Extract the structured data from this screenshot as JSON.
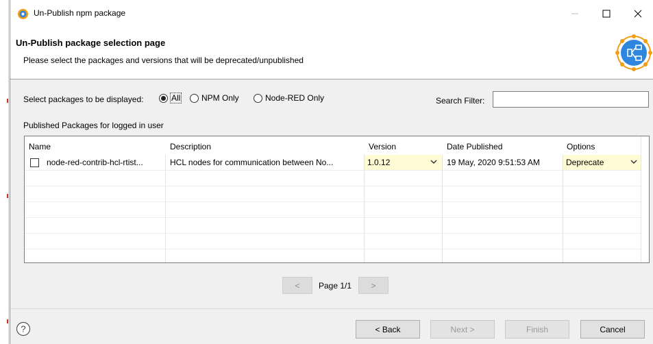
{
  "window": {
    "title": "Un-Publish npm package",
    "minimize": "—",
    "maximize": "☐",
    "close": "✕"
  },
  "banner": {
    "title": "Un-Publish package selection page",
    "description": "Please select the packages and versions that will be deprecated/unpublished",
    "icon": "npm-package-icon"
  },
  "filter": {
    "label": "Select packages to be displayed:",
    "options": [
      {
        "label": "All",
        "selected": true
      },
      {
        "label": "NPM Only",
        "selected": false
      },
      {
        "label": "Node-RED Only",
        "selected": false
      }
    ],
    "search_label": "Search Filter:",
    "search_value": ""
  },
  "table": {
    "section_label": "Published Packages for logged in user",
    "columns": [
      "Name",
      "Description",
      "Version",
      "Date Published",
      "Options"
    ],
    "rows": [
      {
        "checked": false,
        "name": "node-red-contrib-hcl-rtist...",
        "description": "HCL nodes for communication between No...",
        "version": "1.0.12",
        "date": "19 May, 2020 9:51:53 AM",
        "option": "Deprecate"
      }
    ]
  },
  "pager": {
    "prev": "<",
    "text": "Page 1/1",
    "next": ">"
  },
  "footer": {
    "help_icon": "help-icon",
    "back": "< Back",
    "next": "Next >",
    "finish": "Finish",
    "cancel": "Cancel"
  },
  "colors": {
    "combo_bg": "#fffbd5",
    "dialog_bg": "#f0f0f0",
    "icon_orange": "#f39c12",
    "icon_blue": "#2e86de"
  }
}
